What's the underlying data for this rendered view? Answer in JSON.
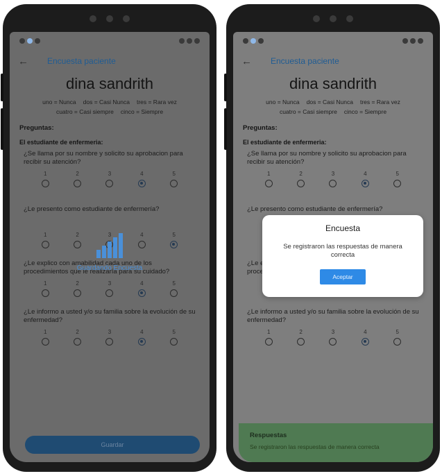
{
  "survey": {
    "title": "Encuesta paciente",
    "back_icon": "arrow-left-icon",
    "patient_name": "dina sandrith",
    "legend": [
      "uno = Nunca",
      "dos = Casi Nunca",
      "tres = Rara vez",
      "cuatro = Casi siempre",
      "cinco = Siempre"
    ],
    "section_label": "Preguntas:",
    "category_label": "El estudiante de enfermeria:",
    "scale_labels": [
      "1",
      "2",
      "3",
      "4",
      "5"
    ],
    "questions": [
      {
        "text": "¿Se llama por su nombre y solicito su aprobacion para recibir su atención?",
        "selected": 4
      },
      {
        "text": "¿Le presento como estudiante de enfermería?",
        "selected": 5
      },
      {
        "text": "¿Le explico con amabilidad cada uno de los procedimientos que le realizaría para su cuidado?",
        "selected": 4
      },
      {
        "text": "¿Le informo a usted y/o su familia sobre la evolución de su enfermedad?",
        "selected": 4
      }
    ],
    "submit_label": "Guardar"
  },
  "loading": {
    "text": "Guardando Encuesta",
    "icon": "signal-bars-icon"
  },
  "dialog": {
    "title": "Encuesta",
    "message": "Se registraron las respuestas de manera correcta",
    "button_label": "Aceptar"
  },
  "snackbar": {
    "title": "Respuestas",
    "message": "Se registraron las respuestas de manera correcta"
  },
  "colors": {
    "accent": "#2e8ae6",
    "appbar_title": "#1f5c94",
    "snackbar_bg": "#4f7a52"
  }
}
